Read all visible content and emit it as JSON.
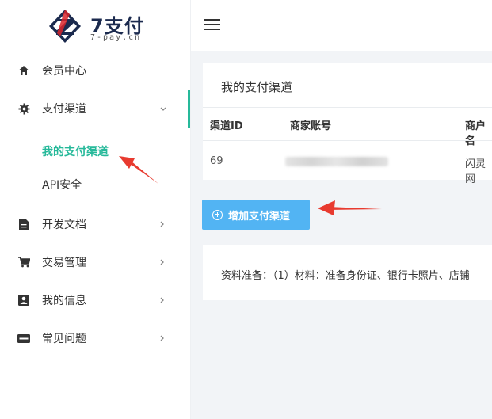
{
  "brand": {
    "name": "7支付",
    "sub": "7-pay.cn"
  },
  "nav": {
    "items": [
      {
        "label": "会员中心",
        "icon": "home-icon"
      },
      {
        "label": "支付渠道",
        "icon": "gear-icon",
        "expanded": true
      },
      {
        "label": "开发文档",
        "icon": "document-icon"
      },
      {
        "label": "交易管理",
        "icon": "cart-icon"
      },
      {
        "label": "我的信息",
        "icon": "profile-icon"
      },
      {
        "label": "常见问题",
        "icon": "new-badge-icon"
      }
    ],
    "sub_items": [
      {
        "label": "我的支付渠道",
        "active": true
      },
      {
        "label": "API安全",
        "active": false
      }
    ]
  },
  "main": {
    "card_title": "我的支付渠道",
    "table": {
      "headers": [
        "渠道ID",
        "商家账号",
        "商户名"
      ],
      "rows": [
        {
          "id": "69",
          "account": "",
          "merchant": "闪灵网"
        }
      ]
    },
    "add_button": "增加支付渠道",
    "notice": "资料准备：（1）材料：准备身份证、银行卡照片、店铺"
  },
  "colors": {
    "accent": "#26b99a",
    "button": "#52b4f3",
    "arrow": "#e83a2f"
  }
}
